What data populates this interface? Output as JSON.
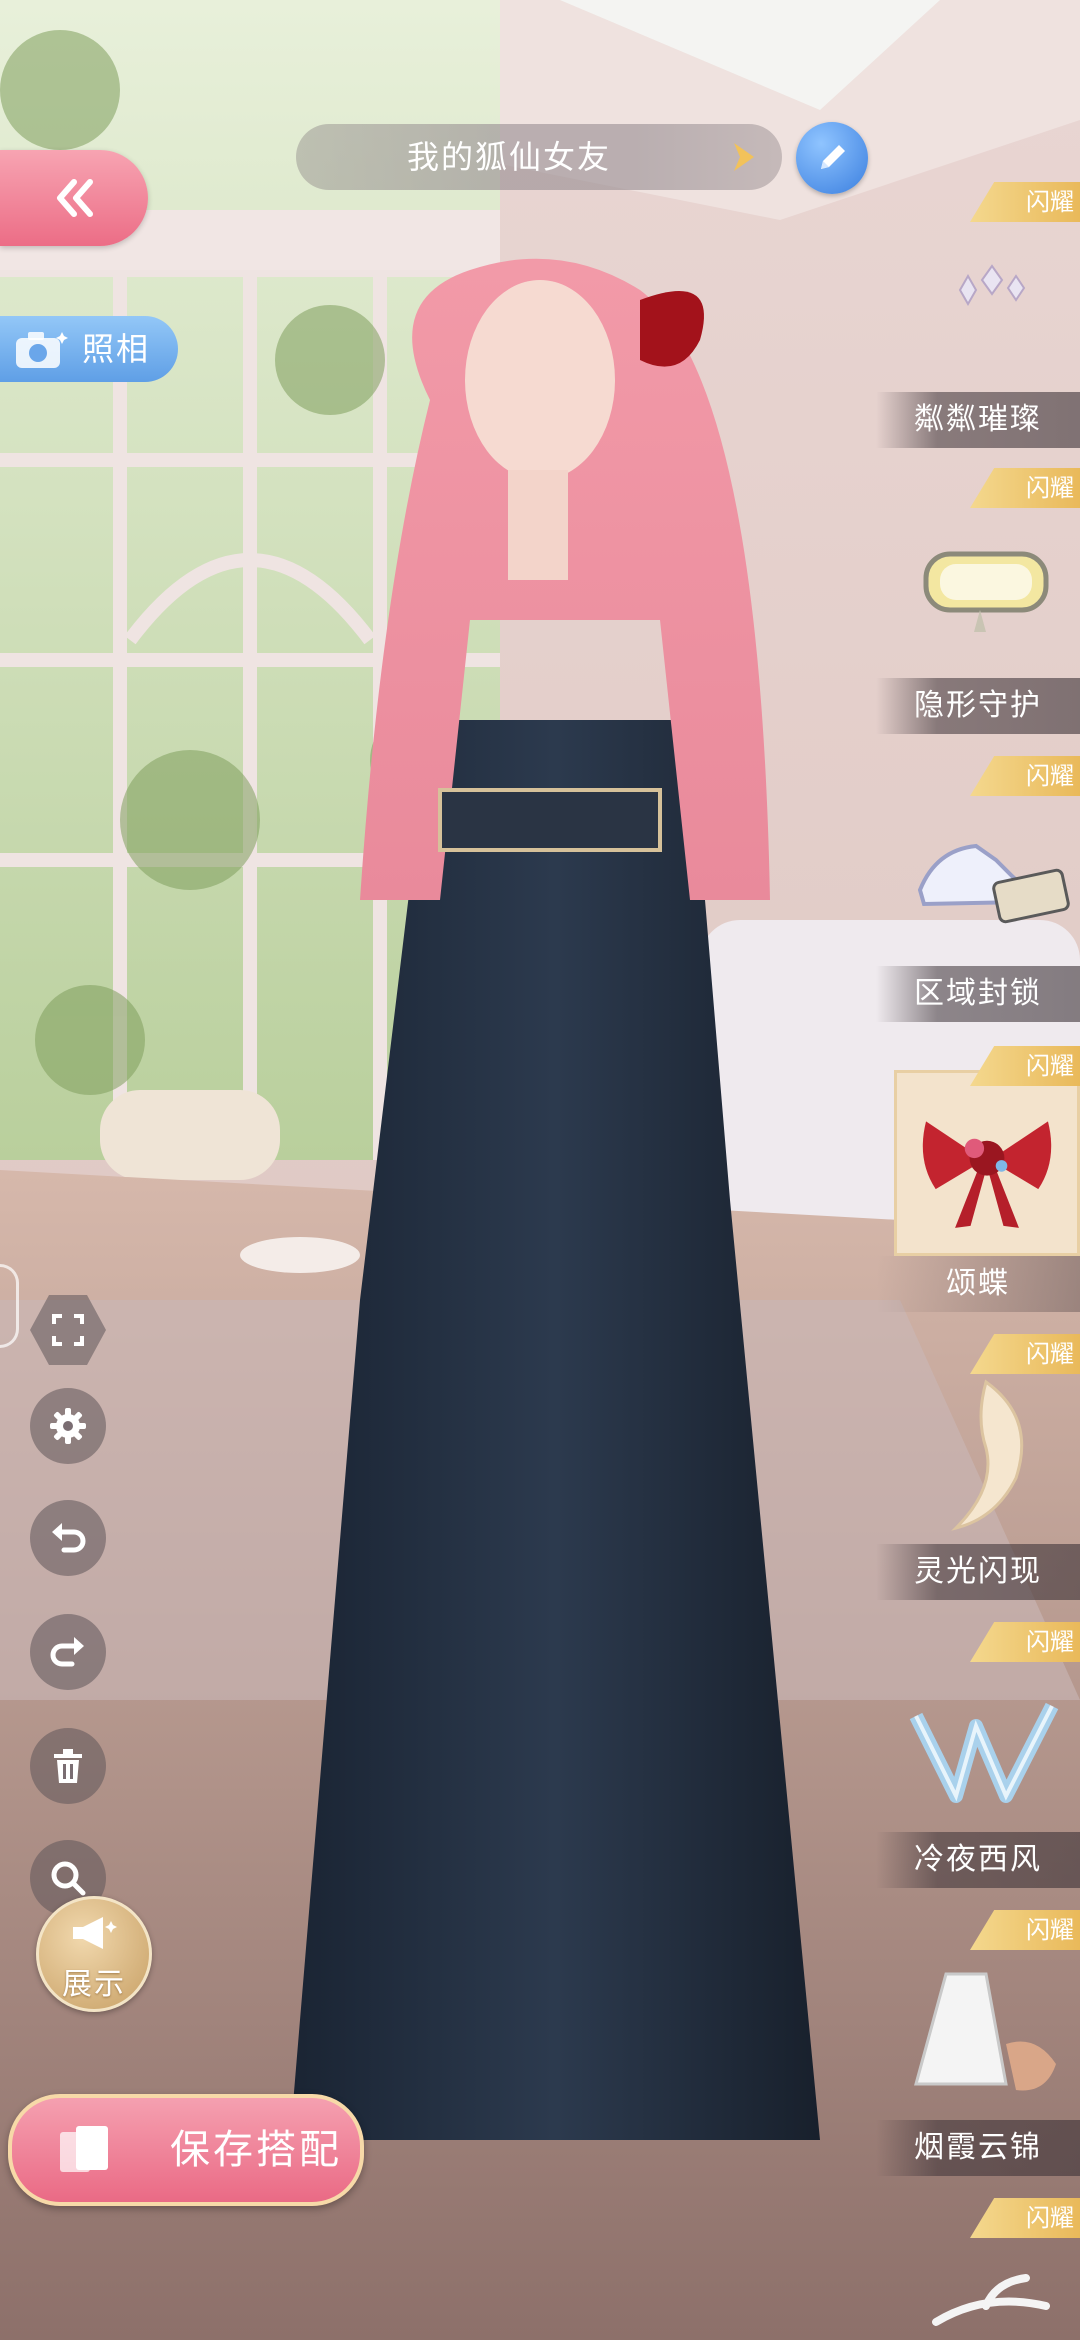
{
  "header": {
    "title": "我的狐仙女友"
  },
  "photo_button": {
    "label": "照相"
  },
  "left_toolbar": {
    "show_label": "展示",
    "save_label": "保存搭配"
  },
  "items": [
    {
      "name": "粼粼璀璨",
      "badge": "闪耀",
      "icon": "sparkle-earrings"
    },
    {
      "name": "隐形守护",
      "badge": "闪耀",
      "icon": "goggles"
    },
    {
      "name": "区域封锁",
      "badge": "闪耀",
      "icon": "sneaker"
    },
    {
      "name": "颂蝶",
      "badge": "闪耀",
      "icon": "red-bow",
      "selected": true
    },
    {
      "name": "灵光闪现",
      "badge": "闪耀",
      "icon": "feather-tail"
    },
    {
      "name": "冷夜西风",
      "badge": "闪耀",
      "icon": "crystal-wings"
    },
    {
      "name": "烟霞云锦",
      "badge": "闪耀",
      "icon": "veil"
    },
    {
      "name": "",
      "badge": "闪耀",
      "icon": "white-branch"
    }
  ]
}
